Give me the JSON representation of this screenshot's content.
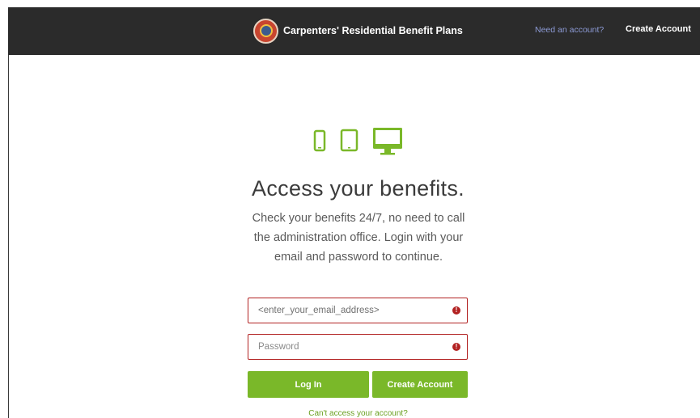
{
  "header": {
    "brand_name": "Carpenters' Residential Benefit Plans",
    "need_account": "Need an account?",
    "create_account": "Create Account"
  },
  "icons": [
    "phone-icon",
    "tablet-icon",
    "desktop-icon"
  ],
  "main": {
    "headline": "Access your benefits.",
    "description": "Check your benefits 24/7, no need to call the administration office. Login with your email and password to continue."
  },
  "form": {
    "email_value": "<enter_your_email_address>",
    "password_placeholder": "Password",
    "error_glyph": "!",
    "login_label": "Log In",
    "create_label": "Create Account",
    "cant_access": "Can't access your account?"
  },
  "colors": {
    "header_bg": "#2b2b2b",
    "accent_green": "#7ab829",
    "error_red": "#b22222",
    "link_blue": "#8d9bd6"
  }
}
